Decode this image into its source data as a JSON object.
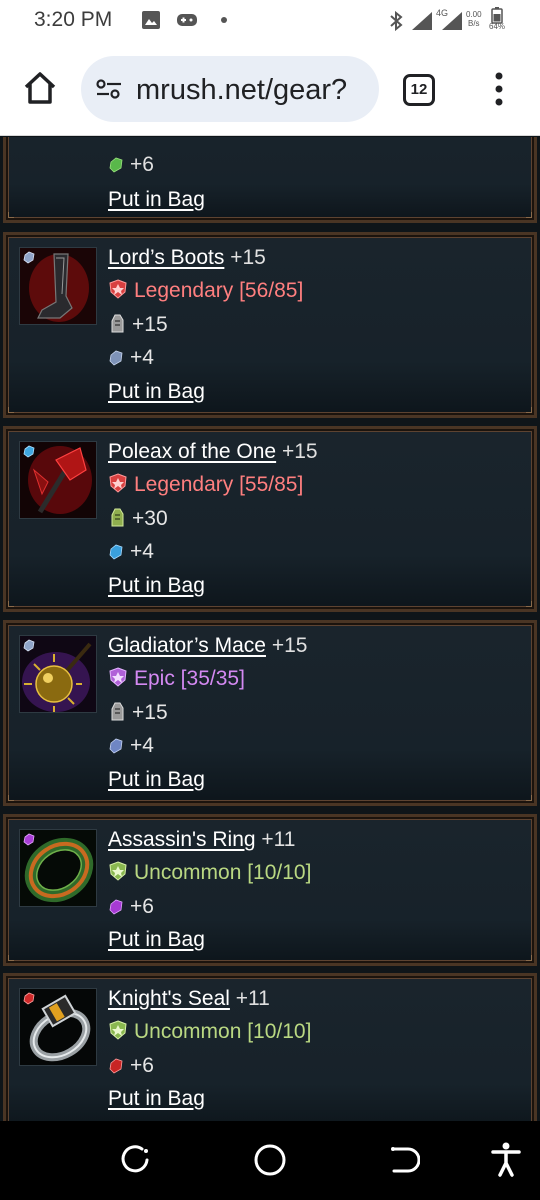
{
  "status": {
    "time": "3:20 PM",
    "net_top": "0.00",
    "net_bottom": "B/s",
    "signal": "4G",
    "battery": "64%"
  },
  "browser": {
    "url": "mrush.net/gear?",
    "tab_count": "12"
  },
  "items": [
    {
      "stat1": "+6",
      "bag": "Put in Bag"
    },
    {
      "name": "Lord’s Boots",
      "level": "+15",
      "rarity": "Legendary [56/85]",
      "stat1": "+15",
      "stat2": "+4",
      "bag": "Put in Bag"
    },
    {
      "name": "Poleax of the One",
      "level": "+15",
      "rarity": "Legendary [55/85]",
      "stat1": "+30",
      "stat2": "+4",
      "bag": "Put in Bag"
    },
    {
      "name": "Gladiator’s Mace",
      "level": "+15",
      "rarity": "Epic [35/35]",
      "stat1": "+15",
      "stat2": "+4",
      "bag": "Put in Bag"
    },
    {
      "name": "Assassin's Ring",
      "level": "+11",
      "rarity": "Uncommon [10/10]",
      "stat1": "+6",
      "bag": "Put in Bag"
    },
    {
      "name": "Knight's Seal",
      "level": "+11",
      "rarity": "Uncommon [10/10]",
      "stat1": "+6",
      "bag": "Put in Bag"
    }
  ],
  "colors": {
    "legendary": "#ff7f7f",
    "epic": "#d489f2",
    "uncommon": "#b9d882",
    "frame": "#4a3524"
  },
  "icons": [
    "home-icon",
    "tune-icon",
    "tabs-icon",
    "menu-icon",
    "rarity-shield-icon",
    "strength-icon",
    "gem-icon",
    "recent-apps-icon",
    "home-circle-icon",
    "back-icon",
    "accessibility-icon"
  ]
}
